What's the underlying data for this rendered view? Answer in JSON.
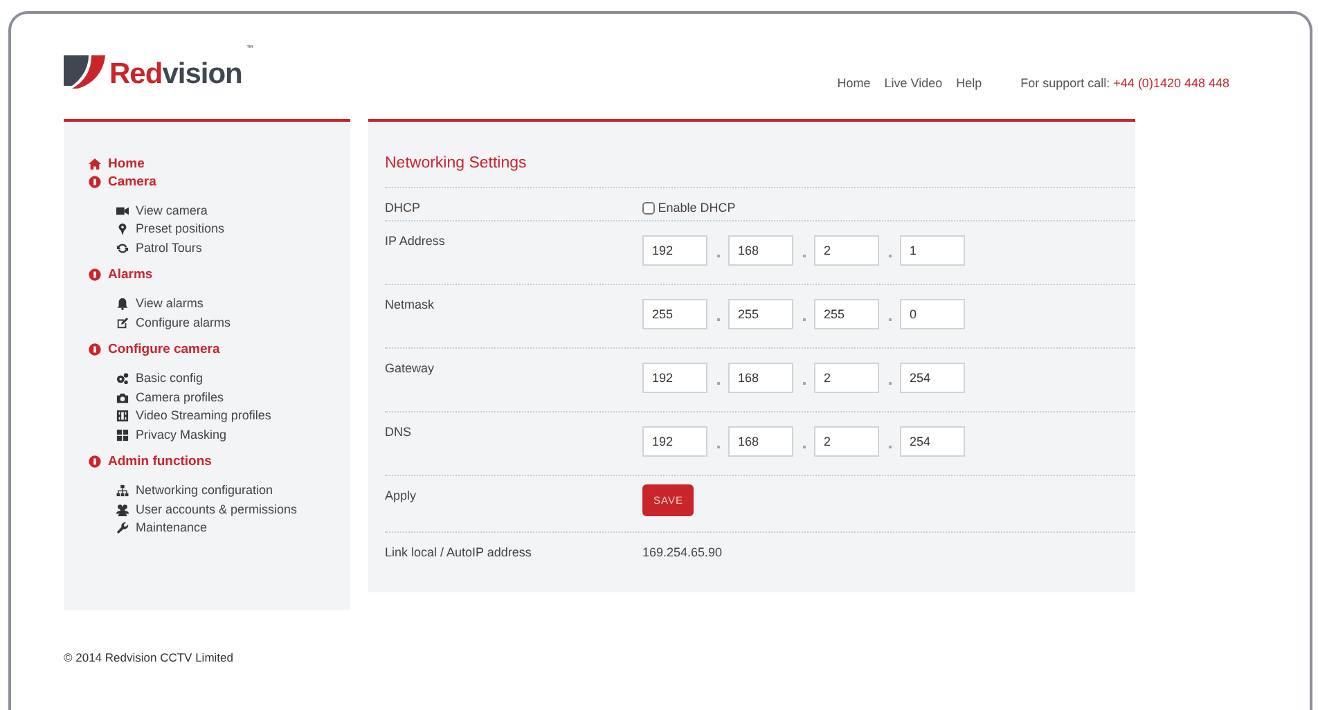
{
  "logo": {
    "parts": [
      {
        "text": "Red",
        "kind": "accent"
      },
      {
        "text": "vision",
        "kind": "plain"
      }
    ],
    "tm": "™"
  },
  "top_nav": [
    "Home",
    "Live Video",
    "Help"
  ],
  "support": {
    "label": "For support call:",
    "phone": "+44 (0)1420 448 448"
  },
  "sidebar": [
    {
      "label": "Home",
      "kind": "link"
    },
    {
      "label": "Camera",
      "kind": "section",
      "children": [
        "View camera",
        "Preset positions",
        "Patrol Tours"
      ]
    },
    {
      "label": "Alarms",
      "kind": "section",
      "children": [
        "View alarms",
        "Configure alarms"
      ]
    },
    {
      "label": "Configure camera",
      "kind": "section",
      "children": [
        "Basic config",
        "Camera profiles",
        "Video Streaming profiles",
        "Privacy Masking"
      ]
    },
    {
      "label": "Admin functions",
      "kind": "section",
      "children": [
        "Networking configuration",
        "User accounts & permissions",
        "Maintenance"
      ]
    }
  ],
  "panel_title": "Networking Settings",
  "rows": [
    {
      "kind": "checkbox",
      "label": "DHCP",
      "text": "Enable DHCP",
      "checked": false
    },
    {
      "kind": "ip",
      "label": "IP Address",
      "octets": [
        "192",
        "168",
        "2",
        "1"
      ]
    },
    {
      "kind": "ip",
      "label": "Netmask",
      "octets": [
        "255",
        "255",
        "255",
        "0"
      ]
    },
    {
      "kind": "ip",
      "label": "Gateway",
      "octets": [
        "192",
        "168",
        "2",
        "254"
      ]
    },
    {
      "kind": "ip",
      "label": "DNS",
      "octets": [
        "192",
        "168",
        "2",
        "254"
      ]
    },
    {
      "kind": "button",
      "label": "Apply",
      "text": "SAVE"
    },
    {
      "kind": "text",
      "label": "Link local / AutoIP address",
      "text": "169.254.65.90"
    }
  ],
  "footer": "© 2014 Redvision CCTV Limited"
}
